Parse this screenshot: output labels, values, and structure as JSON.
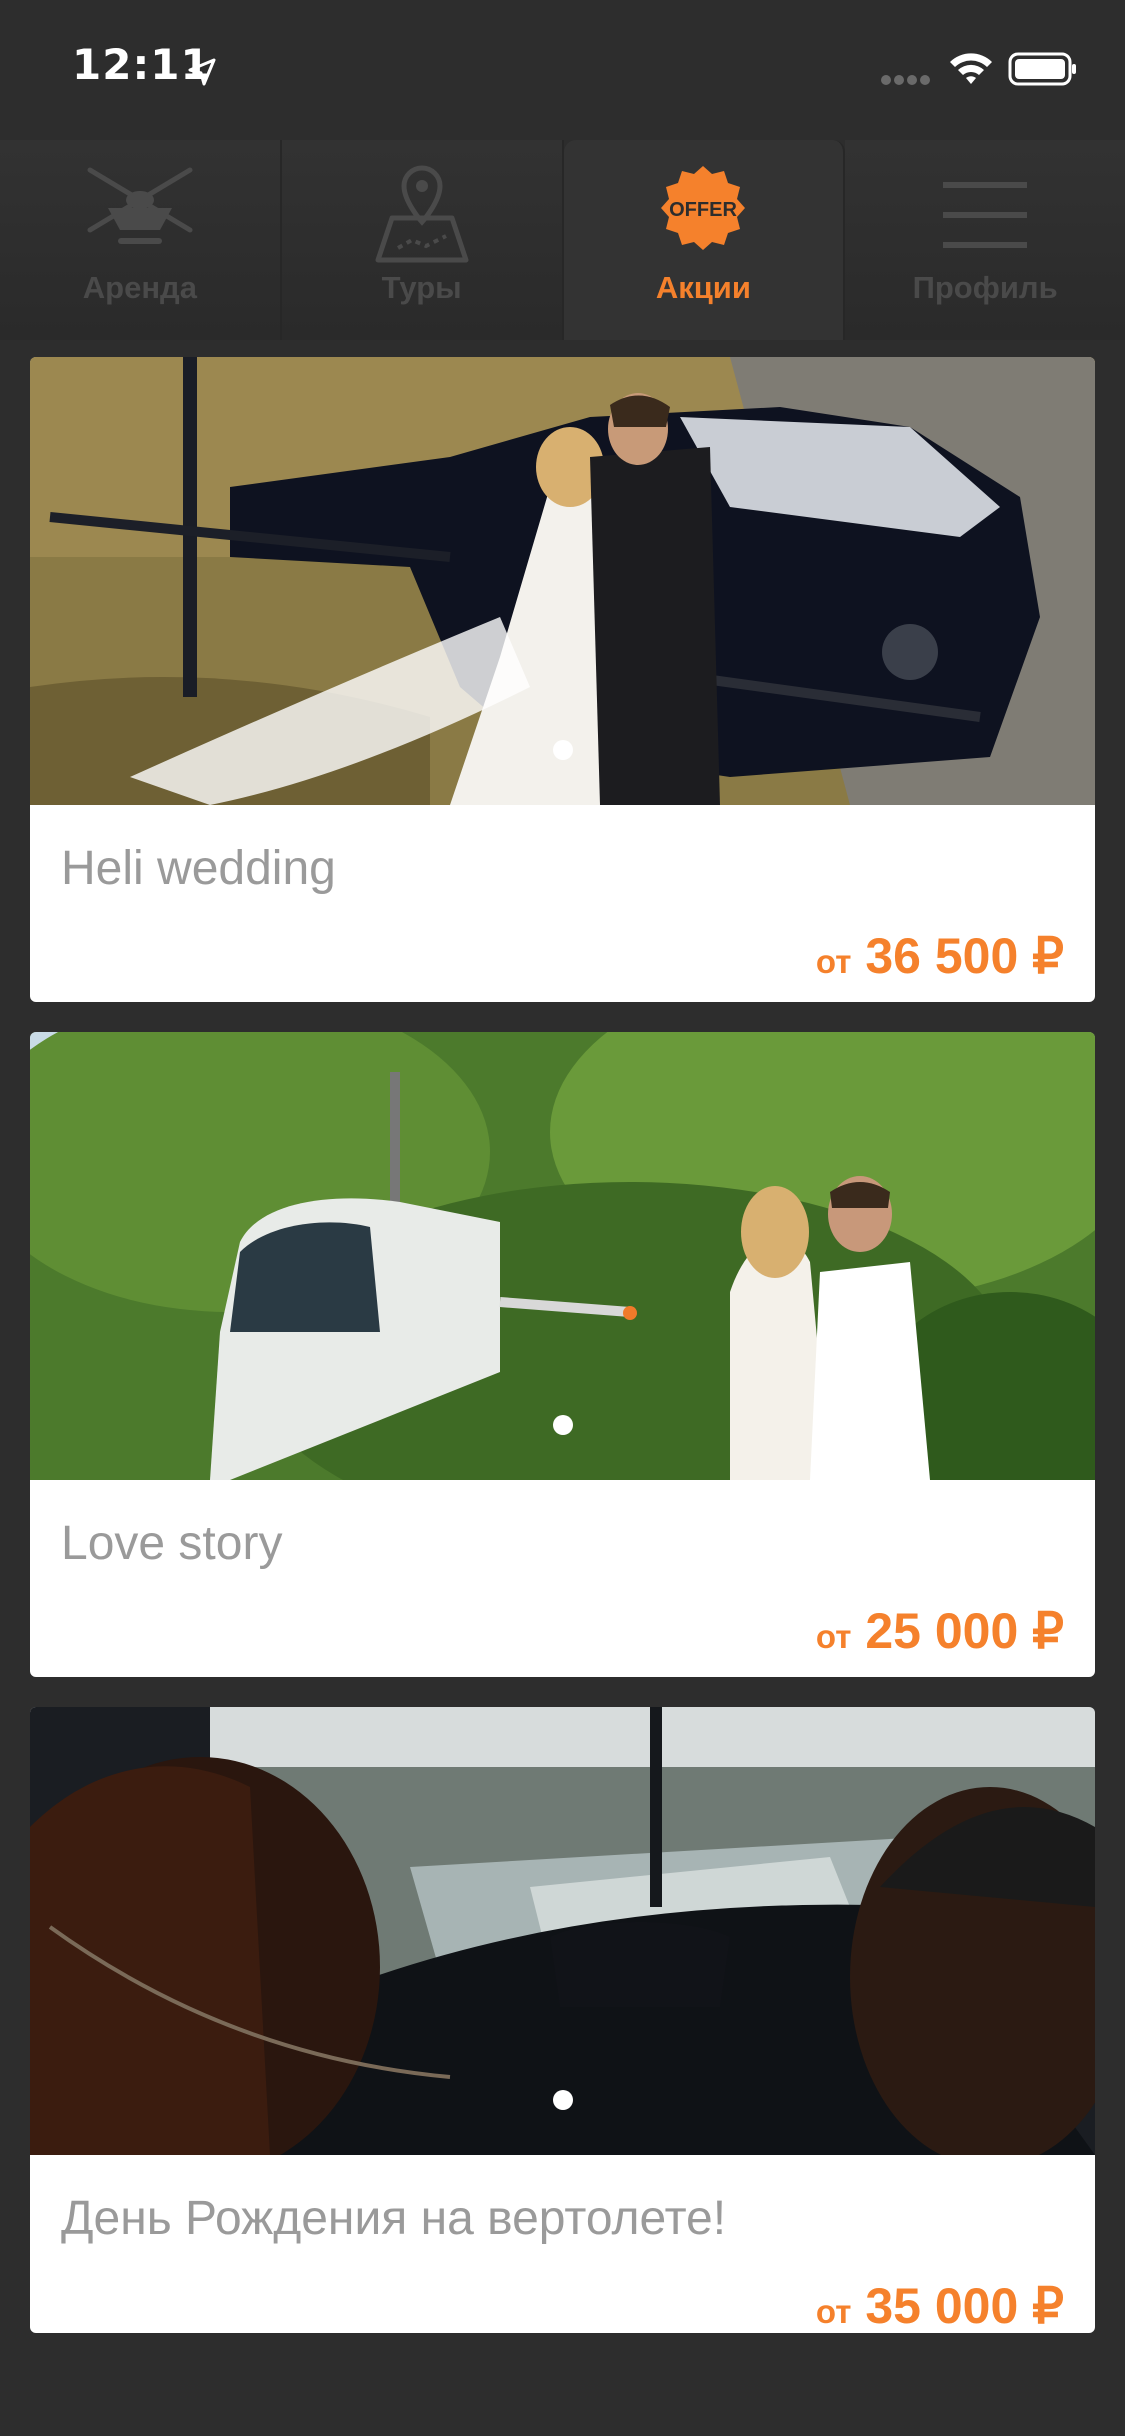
{
  "status_bar": {
    "time": "12:11",
    "icons": [
      "location-arrow-icon",
      "signal-icon",
      "wifi-icon",
      "battery-icon"
    ]
  },
  "tabs": [
    {
      "label": "Аренда",
      "icon": "helicopter-icon",
      "active": false
    },
    {
      "label": "Туры",
      "icon": "map-pin-icon",
      "active": false
    },
    {
      "label": "Акции",
      "icon": "offer-badge-icon",
      "badge_text": "OFFER",
      "active": true
    },
    {
      "label": "Профиль",
      "icon": "menu-icon",
      "active": false
    }
  ],
  "offers": [
    {
      "title": "Heli wedding",
      "price_prefix": "от",
      "price": "36 500 ₽",
      "photo": "wedding-couple-with-black-helicopter"
    },
    {
      "title": "Love story",
      "price_prefix": "от",
      "price": "25 000 ₽",
      "photo": "couple-with-white-helicopter-in-forest"
    },
    {
      "title": "День Рождения на вертолете!",
      "price_prefix": "от",
      "price": "35 000 ₽",
      "photo": "city-view-from-helicopter-cockpit"
    }
  ],
  "colors": {
    "background": "#2d2d2d",
    "accent": "#f5812c",
    "card": "#ffffff",
    "title_text": "#9a9a9a",
    "inactive_tab": "#4a4a4a"
  }
}
